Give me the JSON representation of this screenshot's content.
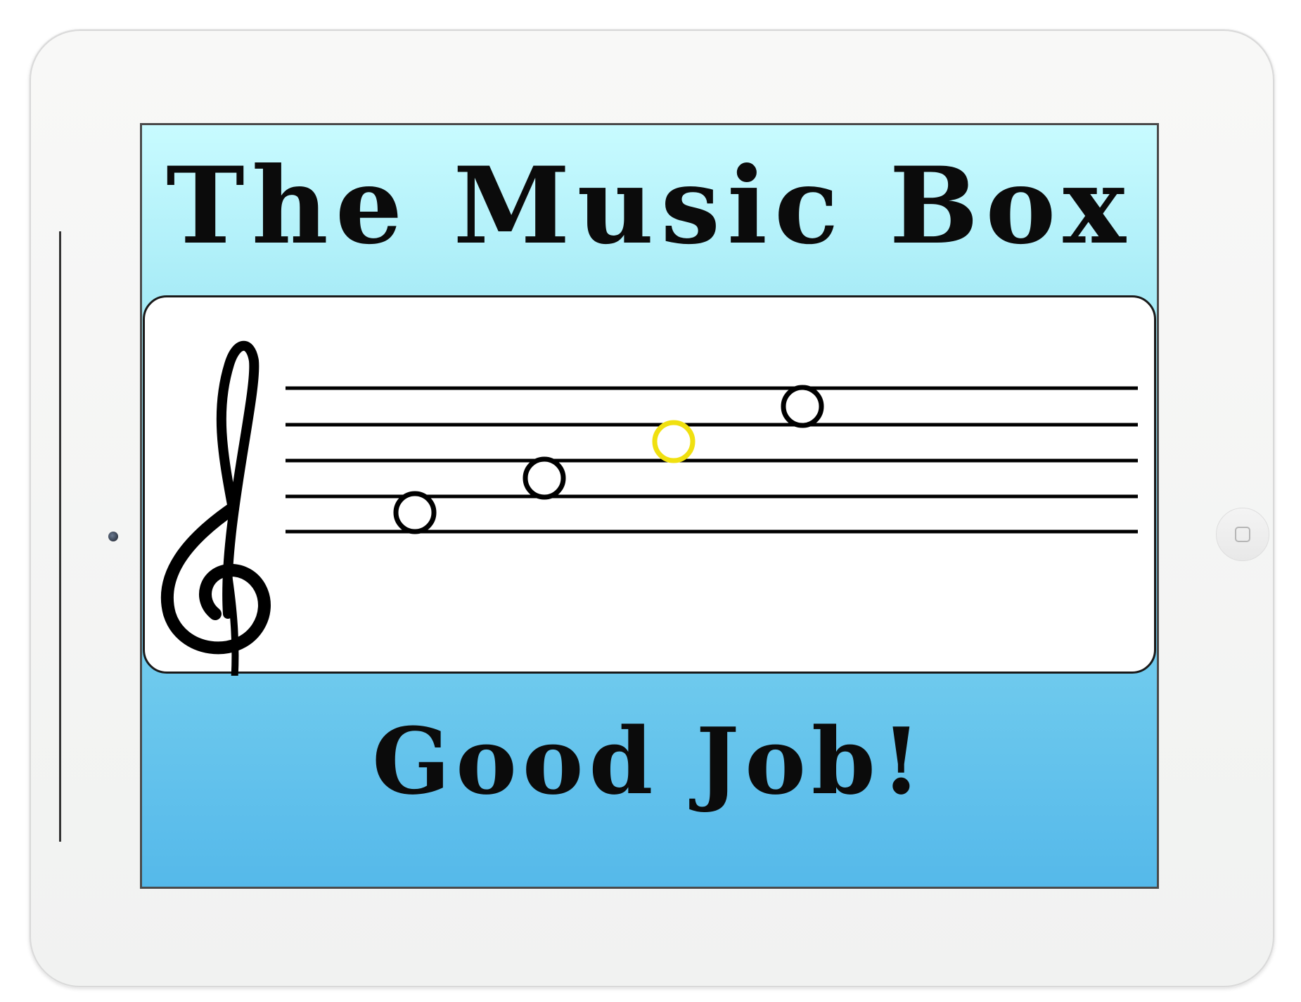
{
  "app": {
    "title": "The Music Box",
    "feedback_message": "Good Job!"
  },
  "staff": {
    "clef": "treble-clef-icon",
    "line_count": 5,
    "notes": [
      {
        "name": "note-1",
        "state": "default",
        "color": "#000000"
      },
      {
        "name": "note-2",
        "state": "default",
        "color": "#000000"
      },
      {
        "name": "note-3",
        "state": "highlighted",
        "color": "#f0e010"
      },
      {
        "name": "note-4",
        "state": "default",
        "color": "#000000"
      }
    ]
  },
  "colors": {
    "screen_top": "#c8fbff",
    "screen_bottom": "#55b9ea",
    "highlight": "#f0e010"
  }
}
